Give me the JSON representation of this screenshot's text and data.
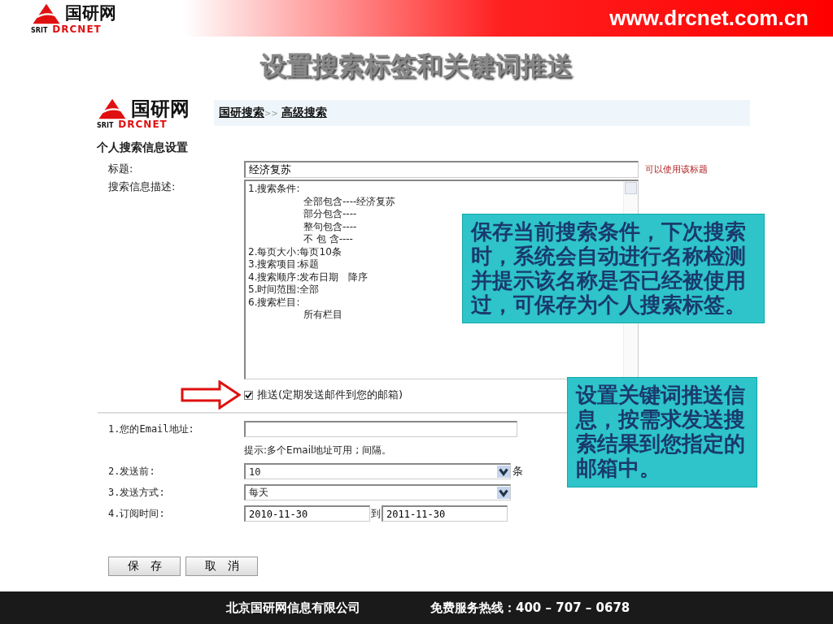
{
  "header": {
    "logo": {
      "name": "国研网",
      "sub_left": "SRIT",
      "sub_right": "DRCNET"
    },
    "url": "www.drcnet.com.cn"
  },
  "slide_title": "设置搜索标签和关键词推送",
  "page": {
    "logo": {
      "name": "国研网",
      "sub_left": "SRIT",
      "sub_right": "DRCNET"
    },
    "breadcrumb": [
      {
        "label": "国研搜索"
      },
      {
        "separator": ">>",
        "label": "高级搜索"
      }
    ],
    "section_title": "个人搜索信息设置",
    "title_field": {
      "label": "标题:",
      "value": "经济复苏",
      "hint": "可以使用该标题"
    },
    "description": {
      "label": "搜索信息描述:",
      "lines": [
        {
          "text": "1.搜索条件:",
          "children": [
            {
              "text": "全部包含----经济复苏"
            },
            {
              "text": "部分包含----"
            },
            {
              "text": "整句包含----"
            },
            {
              "text": "不 包 含----"
            }
          ]
        },
        {
          "text": "2.每页大小:每页10条"
        },
        {
          "text": "3.搜索项目:标题"
        },
        {
          "text": "4.搜索顺序:发布日期　降序"
        },
        {
          "text": "5.时间范围:全部"
        },
        {
          "text": "6.搜索栏目:",
          "children": [
            {
              "text": "所有栏目"
            }
          ]
        }
      ]
    },
    "push_checkbox": {
      "label": "推送(定期发送邮件到您的邮箱)",
      "checked": true
    },
    "email": {
      "label": "1.您的Email地址:",
      "hint": "提示:多个Email地址可用 ; 间隔。"
    },
    "send_count": {
      "label": "2.发送前:",
      "value": "10",
      "unit": "条"
    },
    "send_mode": {
      "label": "3.发送方式:",
      "value": "每天"
    },
    "subscribe_time": {
      "label": "4.订阅时间:",
      "from": "2010-11-30",
      "separator": "到",
      "to": "2011-11-30"
    },
    "buttons": [
      "保　存",
      "取　消"
    ]
  },
  "callouts": [
    {
      "text": "保存当前搜索条件，下次搜索时，系统会自动进行名称检测并提示该名称是否已经被使用过，可保存为个人搜索标签。"
    },
    {
      "text": "设置关键词推送信息，按需求发送搜索结果到您指定的邮箱中。"
    }
  ],
  "footer": {
    "company": "北京国研网信息有限公司",
    "hotline": "免费服务热线：400 – 707 – 0678"
  }
}
